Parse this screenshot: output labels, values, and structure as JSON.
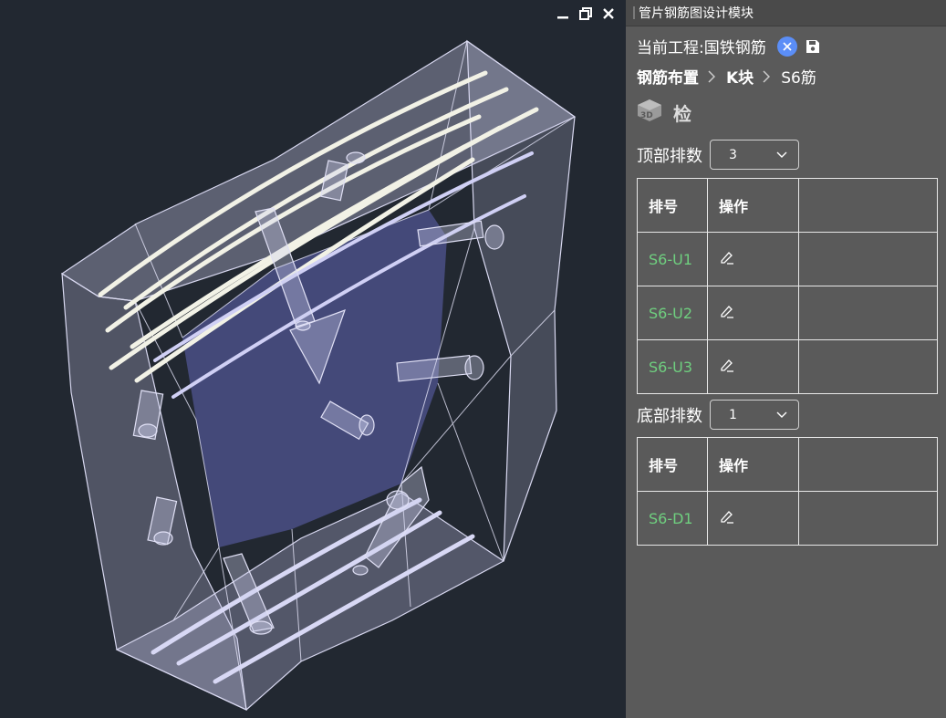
{
  "viewport": {
    "controls": {
      "minimize_icon": "minimize-icon",
      "restore_icon": "restore-icon",
      "close_icon": "close-icon"
    }
  },
  "panel": {
    "title": "管片钢筋图设计模块",
    "project_label": "当前工程:国铁钢筋",
    "breadcrumb": {
      "part1": "钢筋布置",
      "part2": "K块",
      "part3": "S6筋"
    },
    "tool_label": "检",
    "top": {
      "label": "顶部排数",
      "value": "3",
      "headers": {
        "col1": "排号",
        "col2": "操作"
      },
      "rows": [
        {
          "id": "S6-U1"
        },
        {
          "id": "S6-U2"
        },
        {
          "id": "S6-U3"
        }
      ]
    },
    "bottom": {
      "label": "底部排数",
      "value": "1",
      "headers": {
        "col1": "排号",
        "col2": "操作"
      },
      "rows": [
        {
          "id": "S6-D1"
        }
      ]
    }
  },
  "colors": {
    "viewport_bg": "#222831",
    "panel_bg": "#5a5a5a",
    "row_id": "#6fcf7f",
    "close_badge": "#5b8ef7"
  }
}
